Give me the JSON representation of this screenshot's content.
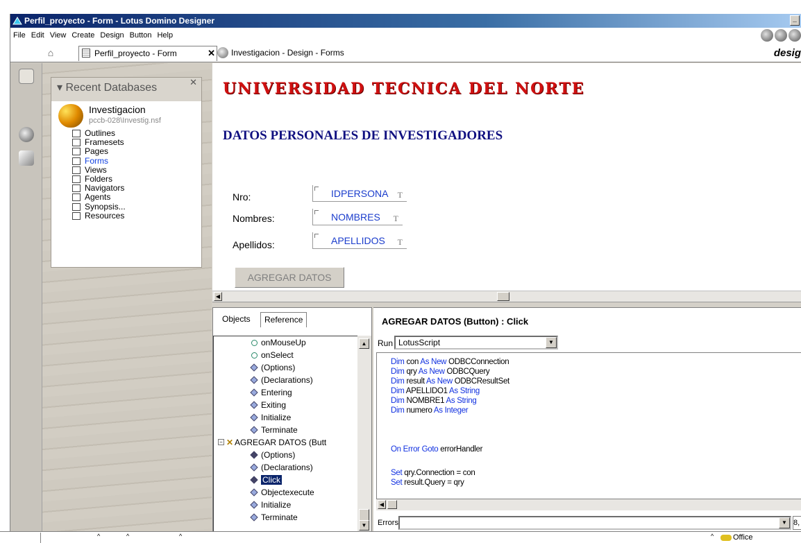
{
  "window": {
    "title": "Perfil_proyecto - Form - Lotus Domino Designer"
  },
  "menubar": {
    "items": [
      "File",
      "Edit",
      "View",
      "Create",
      "Design",
      "Button",
      "Help"
    ]
  },
  "tabs": {
    "active": "Perfil_proyecto - Form",
    "second": "Investigacion - Design - Forms",
    "brand": "desig"
  },
  "nav": {
    "header": "Recent Databases",
    "db_name": "Investigacion",
    "db_path": "pccb-028\\Investig.nsf",
    "items": [
      "Outlines",
      "Framesets",
      "Pages",
      "Forms",
      "Views",
      "Folders",
      "Navigators",
      "Agents",
      "Synopsis...",
      "Resources"
    ]
  },
  "form": {
    "title": "UNIVERSIDAD TECNICA DEL NORTE",
    "subtitle": "DATOS PERSONALES DE INVESTIGADORES",
    "fields": [
      {
        "label": "Nro:",
        "name": "IDPERSONA",
        "type": "T"
      },
      {
        "label": "Nombres:",
        "name": "NOMBRES",
        "type": "T"
      },
      {
        "label": "Apellidos:",
        "name": "APELLIDOS",
        "type": "T"
      }
    ],
    "button": "AGREGAR DATOS"
  },
  "objects": {
    "tab_objects": "Objects",
    "tab_reference": "Reference",
    "tree": [
      "onMouseUp",
      "onSelect",
      "(Options)",
      "(Declarations)",
      "Entering",
      "Exiting",
      "Initialize",
      "Terminate",
      "AGREGAR DATOS (Butt",
      "(Options)",
      "(Declarations)",
      "Click",
      "Objectexecute",
      "Initialize",
      "Terminate"
    ]
  },
  "code": {
    "header": "AGREGAR DATOS (Button) : Click",
    "run_label": "Run",
    "language": "LotusScript",
    "errors_label": "Errors",
    "errors_extra": "8,"
  },
  "status": {
    "office": "Office"
  }
}
